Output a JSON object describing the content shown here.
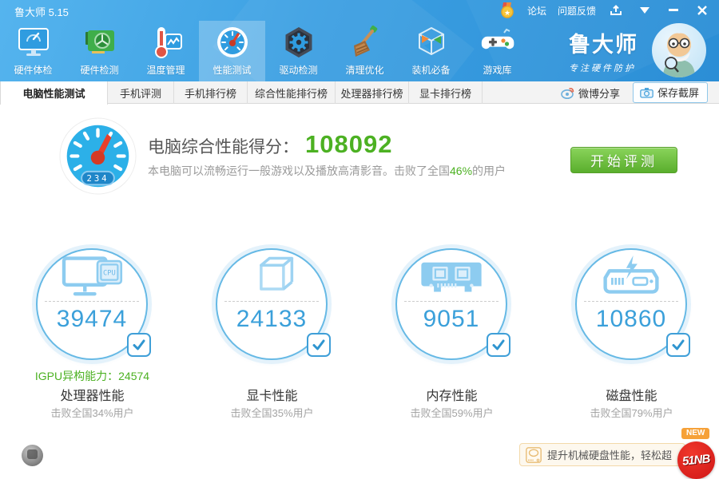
{
  "window": {
    "title": "鲁大师 5.15"
  },
  "titlebar": {
    "links": [
      {
        "label": "论坛"
      },
      {
        "label": "问题反馈"
      }
    ],
    "icons": [
      "medal-icon",
      "share-upload-icon",
      "menu-arrow-icon",
      "minimize-icon",
      "close-icon"
    ]
  },
  "toolbar": {
    "active_item": "性能测试",
    "items": [
      {
        "label": "硬件体检",
        "icon": "monitor-checkup-icon"
      },
      {
        "label": "硬件检测",
        "icon": "gpu-card-icon"
      },
      {
        "label": "温度管理",
        "icon": "thermometer-icon"
      },
      {
        "label": "性能测试",
        "icon": "speedometer-icon"
      },
      {
        "label": "驱动检测",
        "icon": "gear-hexagon-icon"
      },
      {
        "label": "清理优化",
        "icon": "broom-icon"
      },
      {
        "label": "装机必备",
        "icon": "cube-box-icon"
      },
      {
        "label": "游戏库",
        "icon": "gamepad-icon"
      }
    ]
  },
  "brand": {
    "name": "鲁大师",
    "slogan": "专注硬件防护",
    "mascot": "master-lu-mascot"
  },
  "tabs": {
    "active_tab": "电脑性能测试",
    "items": [
      {
        "label": "电脑性能测试"
      },
      {
        "label": "手机评测"
      },
      {
        "label": "手机排行榜"
      },
      {
        "label": "综合性能排行榜"
      },
      {
        "label": "处理器排行榜"
      },
      {
        "label": "显卡排行榜"
      }
    ],
    "weibo_share": "微博分享",
    "save_screenshot": "保存截屏"
  },
  "score": {
    "label": "电脑综合性能得分：",
    "value": "108092",
    "desc_prefix": "本电脑可以流畅运行一般游戏以及播放高清影音。击败了全国",
    "desc_percent": "46%",
    "desc_suffix": "的用户",
    "start_button": "开始评测",
    "dial_value": "234"
  },
  "gauges": [
    {
      "icon": "cpu-monitor-icon",
      "value": "39474",
      "extra": "IGPU异构能力：24574",
      "title": "处理器性能",
      "subtitle": "击败全国34%用户"
    },
    {
      "icon": "gpu-cube-icon",
      "value": "24133",
      "extra": "",
      "title": "显卡性能",
      "subtitle": "击败全国35%用户"
    },
    {
      "icon": "memory-icon",
      "value": "9051",
      "extra": "",
      "title": "内存性能",
      "subtitle": "击败全国59%用户"
    },
    {
      "icon": "disk-icon",
      "value": "10860",
      "extra": "",
      "title": "磁盘性能",
      "subtitle": "击败全国79%用户"
    }
  ],
  "footer": {
    "promo_text": "提升机械硬盘性能，轻松超",
    "new_badge": "NEW",
    "logo_text": "51NB"
  },
  "colors": {
    "header_blue": "#3b9fe2",
    "accent_blue": "#2f9ce0",
    "gauge_number_blue": "#3ba0da",
    "accent_green": "#4cb122",
    "button_green": "#5aae2d",
    "logo_red": "#cf1717",
    "badge_orange": "#f6a138"
  }
}
